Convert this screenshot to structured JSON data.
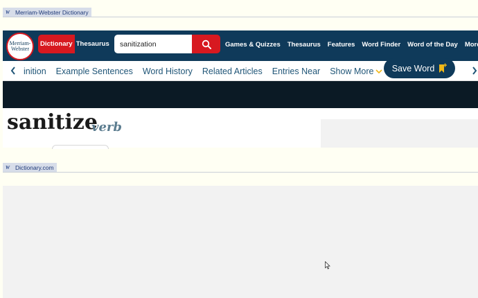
{
  "embeds": [
    {
      "label": "Merriam-Webster Dictionary"
    },
    {
      "label": "Dictionary.com"
    }
  ],
  "mw": {
    "logo_line1": "Merriam-",
    "logo_line2": "Webster",
    "tab_dictionary": "Dictionary",
    "tab_thesaurus": "Thesaurus",
    "search_value": "sanitization",
    "nav": [
      "Games & Quizzes",
      "Thesaurus",
      "Features",
      "Word Finder",
      "Word of the Day",
      "More"
    ],
    "subnav": [
      "inition",
      "Example Sentences",
      "Word History",
      "Related Articles",
      "Entries Near"
    ],
    "show_more": "Show More",
    "save_word": "Save Word",
    "headword": "sanitize",
    "part_of_speech": "verb",
    "colors": {
      "navy": "#0f3a5a",
      "red": "#d71920",
      "link": "#1f5577",
      "gold": "#f1b817"
    }
  }
}
